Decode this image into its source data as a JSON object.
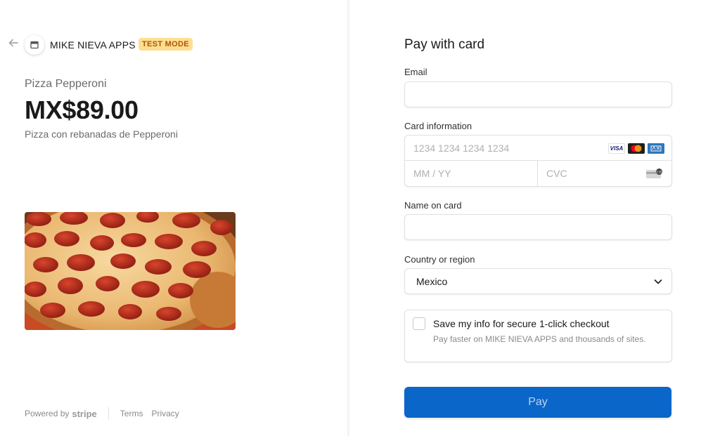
{
  "merchant": {
    "name": "MIKE NIEVA APPS",
    "badge": "TEST MODE"
  },
  "product": {
    "name": "Pizza Pepperoni",
    "price": "MX$89.00",
    "description": "Pizza con rebanadas de Pepperoni",
    "image_icon": "pepperoni-pizza-image"
  },
  "footer": {
    "powered_by": "Powered by",
    "brand": "stripe",
    "links": [
      "Terms",
      "Privacy"
    ]
  },
  "form": {
    "title": "Pay with card",
    "email": {
      "label": "Email",
      "value": "",
      "placeholder": ""
    },
    "card": {
      "label": "Card information",
      "number_placeholder": "1234 1234 1234 1234",
      "expiry_placeholder": "MM / YY",
      "cvc_placeholder": "CVC",
      "brands": [
        "VISA",
        "mastercard",
        "AMEX"
      ],
      "cvc_icon_text": "135"
    },
    "name": {
      "label": "Name on card",
      "value": ""
    },
    "country": {
      "label": "Country or region",
      "value": "Mexico"
    },
    "save": {
      "title": "Save my info for secure 1-click checkout",
      "description": "Pay faster on MIKE NIEVA APPS and thousands of sites.",
      "checked": false
    },
    "pay_button": "Pay"
  },
  "colors": {
    "pay_button": "#0a66c9",
    "test_badge_bg": "#ffde92",
    "test_badge_text": "#a85a00"
  }
}
